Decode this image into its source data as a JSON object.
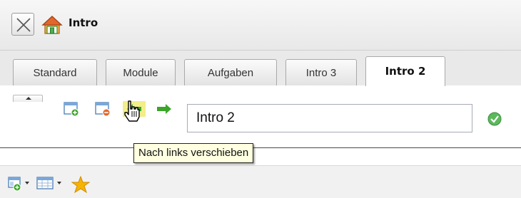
{
  "window": {
    "title": "Intro"
  },
  "tabs": [
    {
      "label": "Standard"
    },
    {
      "label": "Module"
    },
    {
      "label": "Aufgaben"
    },
    {
      "label": "Intro 3"
    },
    {
      "label": "Intro 2",
      "active": true
    }
  ],
  "toolbar": {
    "name_value": "Intro 2",
    "tooltip": "Nach links verschieben",
    "icons": [
      "add-window-icon",
      "remove-window-icon",
      "move-left-icon",
      "move-right-icon",
      "confirm-check-icon"
    ]
  },
  "bottom_toolbar": {
    "icons": [
      "add-layout-icon",
      "layout-menu-icon",
      "favorite-star-icon"
    ]
  },
  "colors": {
    "arrow_green": "#3aa529",
    "check_green": "#5cb85c",
    "tooltip_bg": "#ffffe1",
    "star": "#f6b400"
  }
}
